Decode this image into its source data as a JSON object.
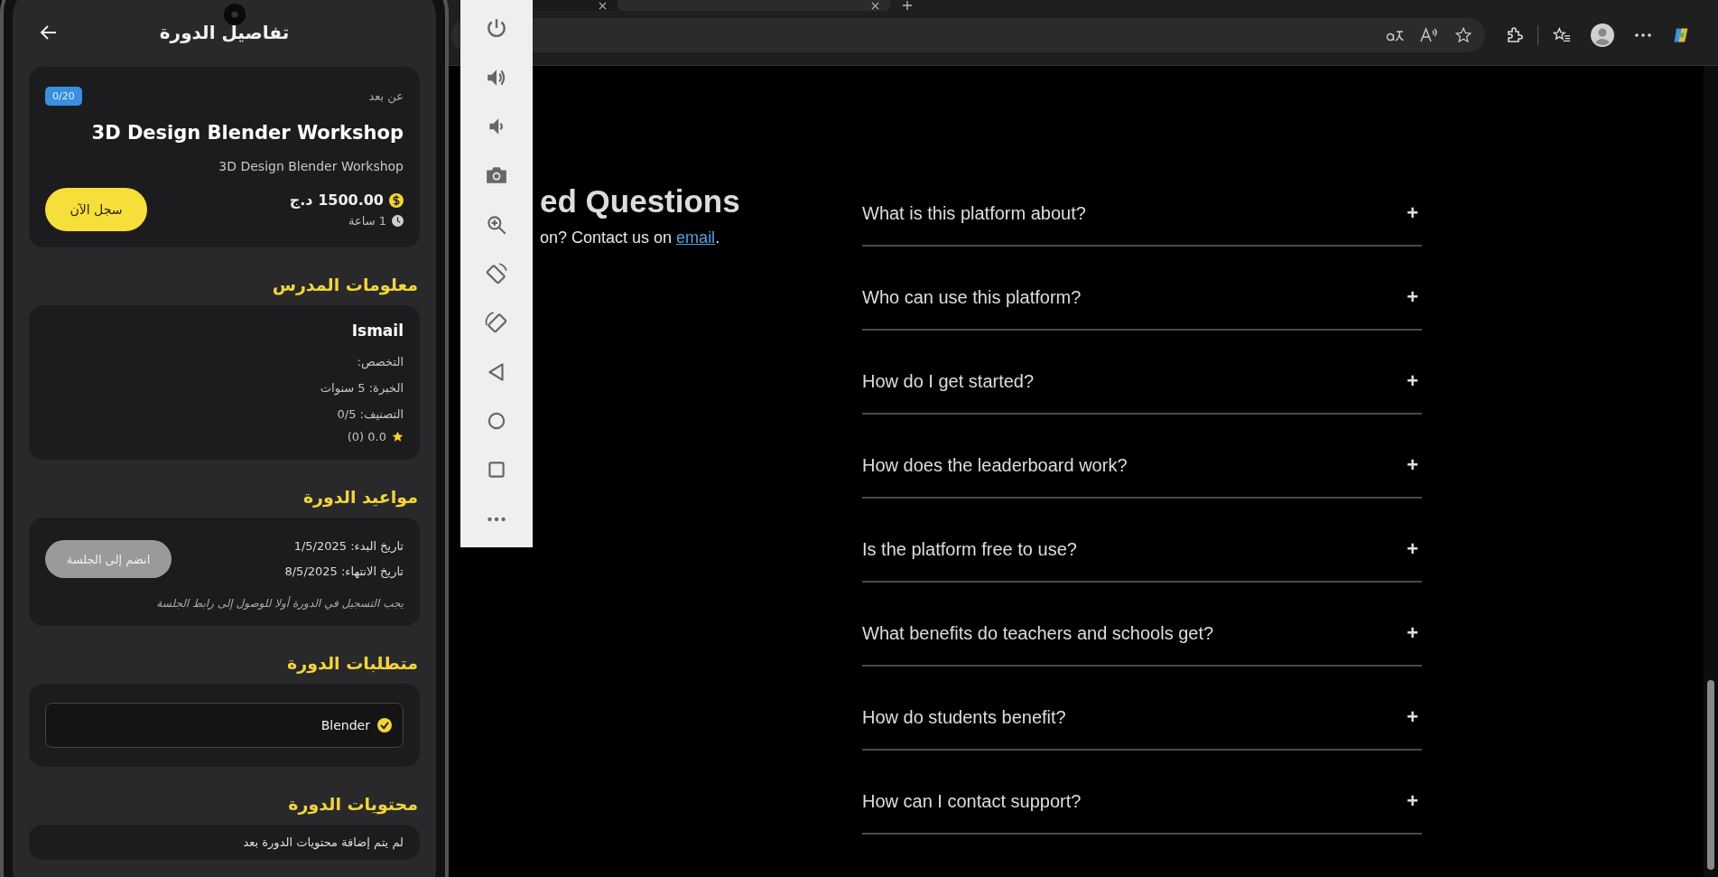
{
  "phone": {
    "header": {
      "title": "تفاصيل الدورة"
    },
    "course": {
      "mode": "عن بعد",
      "badge": "0/20",
      "title": "3D Design Blender Workshop",
      "subtitle": "3D Design Blender Workshop",
      "price": "1500.00 د.ج",
      "duration": "1 ساعة",
      "enroll_button": "سجل الآن"
    },
    "sections": [
      {
        "kind": "teacher",
        "heading": "معلومات المدرس",
        "name": "Ismail",
        "lines": [
          "التخصص:",
          "الخبرة: 5 سنوات",
          "التصنيف: 0/5"
        ],
        "rating": "0.0 (0)"
      },
      {
        "kind": "schedule",
        "heading": "مواعيد الدورة",
        "lines": [
          "تاريخ البدء: 1/5/2025",
          "تاريخ الانتهاء: 8/5/2025"
        ],
        "join_button": {
          "label": "انضم إلى الجلسة",
          "disabled": true
        },
        "note": "يجب التسجيل في الدورة أولا للوصول إلى رابط الجلسة"
      },
      {
        "kind": "requirements",
        "heading": "متطلبات الدورة",
        "items": [
          {
            "label": "Blender",
            "checked": true
          }
        ]
      },
      {
        "kind": "contents",
        "heading": "محتويات الدورة",
        "empty_text": "لم يتم إضافة محتويات الدورة بعد"
      }
    ]
  },
  "faq": {
    "heading": "ed Questions",
    "intro": "on? Contact us on",
    "link": "email",
    "intro_end": ".",
    "questions": [
      {
        "text": "What is this platform about?",
        "icon": "+"
      },
      {
        "text": "Who can use this platform?",
        "icon": "+"
      },
      {
        "text": "How do I get started?",
        "icon": "+"
      },
      {
        "text": "How does the leaderboard work?",
        "icon": "+"
      },
      {
        "text": "Is the platform free to use?",
        "icon": "+"
      },
      {
        "text": "What benefits do teachers and schools get?",
        "icon": "+"
      },
      {
        "text": "How do students benefit?",
        "icon": "+"
      },
      {
        "text": "How can I contact support?",
        "icon": "+"
      }
    ]
  }
}
